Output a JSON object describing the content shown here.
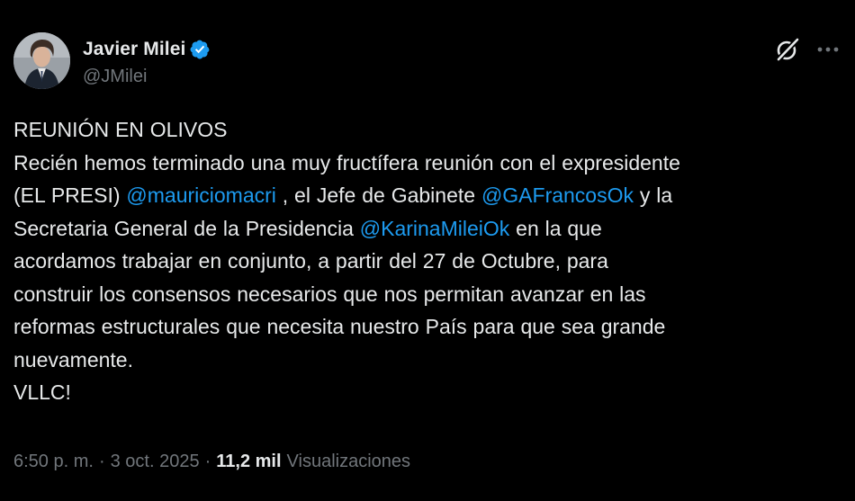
{
  "author": {
    "display_name": "Javier Milei",
    "handle": "@JMilei",
    "verified": true
  },
  "header": {
    "grok_icon": "grok-icon",
    "more_icon": "more-options-icon"
  },
  "tweet": {
    "lines": {
      "l1": "REUNIÓN EN OLIVOS",
      "l2": "Recién hemos terminado una muy fructífera reunión con el expresidente",
      "l3a": "(EL PRESI) ",
      "m1": "@mauriciomacri",
      "l3b": " , el Jefe de Gabinete ",
      "m2": "@GAFrancosOk",
      "l3c": " y la",
      "l4a": "Secretaria General de la Presidencia ",
      "m3": "@KarinaMileiOk",
      "l4b": " en la que",
      "l5": "acordamos trabajar en conjunto, a partir del 27 de Octubre, para",
      "l6": "construir los consensos necesarios que nos permitan avanzar en las",
      "l7": "reformas estructurales que necesita nuestro País para que sea grande",
      "l8": "nuevamente.",
      "l9": "VLLC!"
    }
  },
  "meta": {
    "time": "6:50 p. m.",
    "separator": "·",
    "date": "3 oct. 2025",
    "views_count": "11,2 mil",
    "views_label": "Visualizaciones"
  },
  "colors": {
    "background": "#000000",
    "text": "#e7e9ea",
    "secondary": "#71767b",
    "link": "#1d9bf0",
    "verified": "#1d9bf0"
  }
}
